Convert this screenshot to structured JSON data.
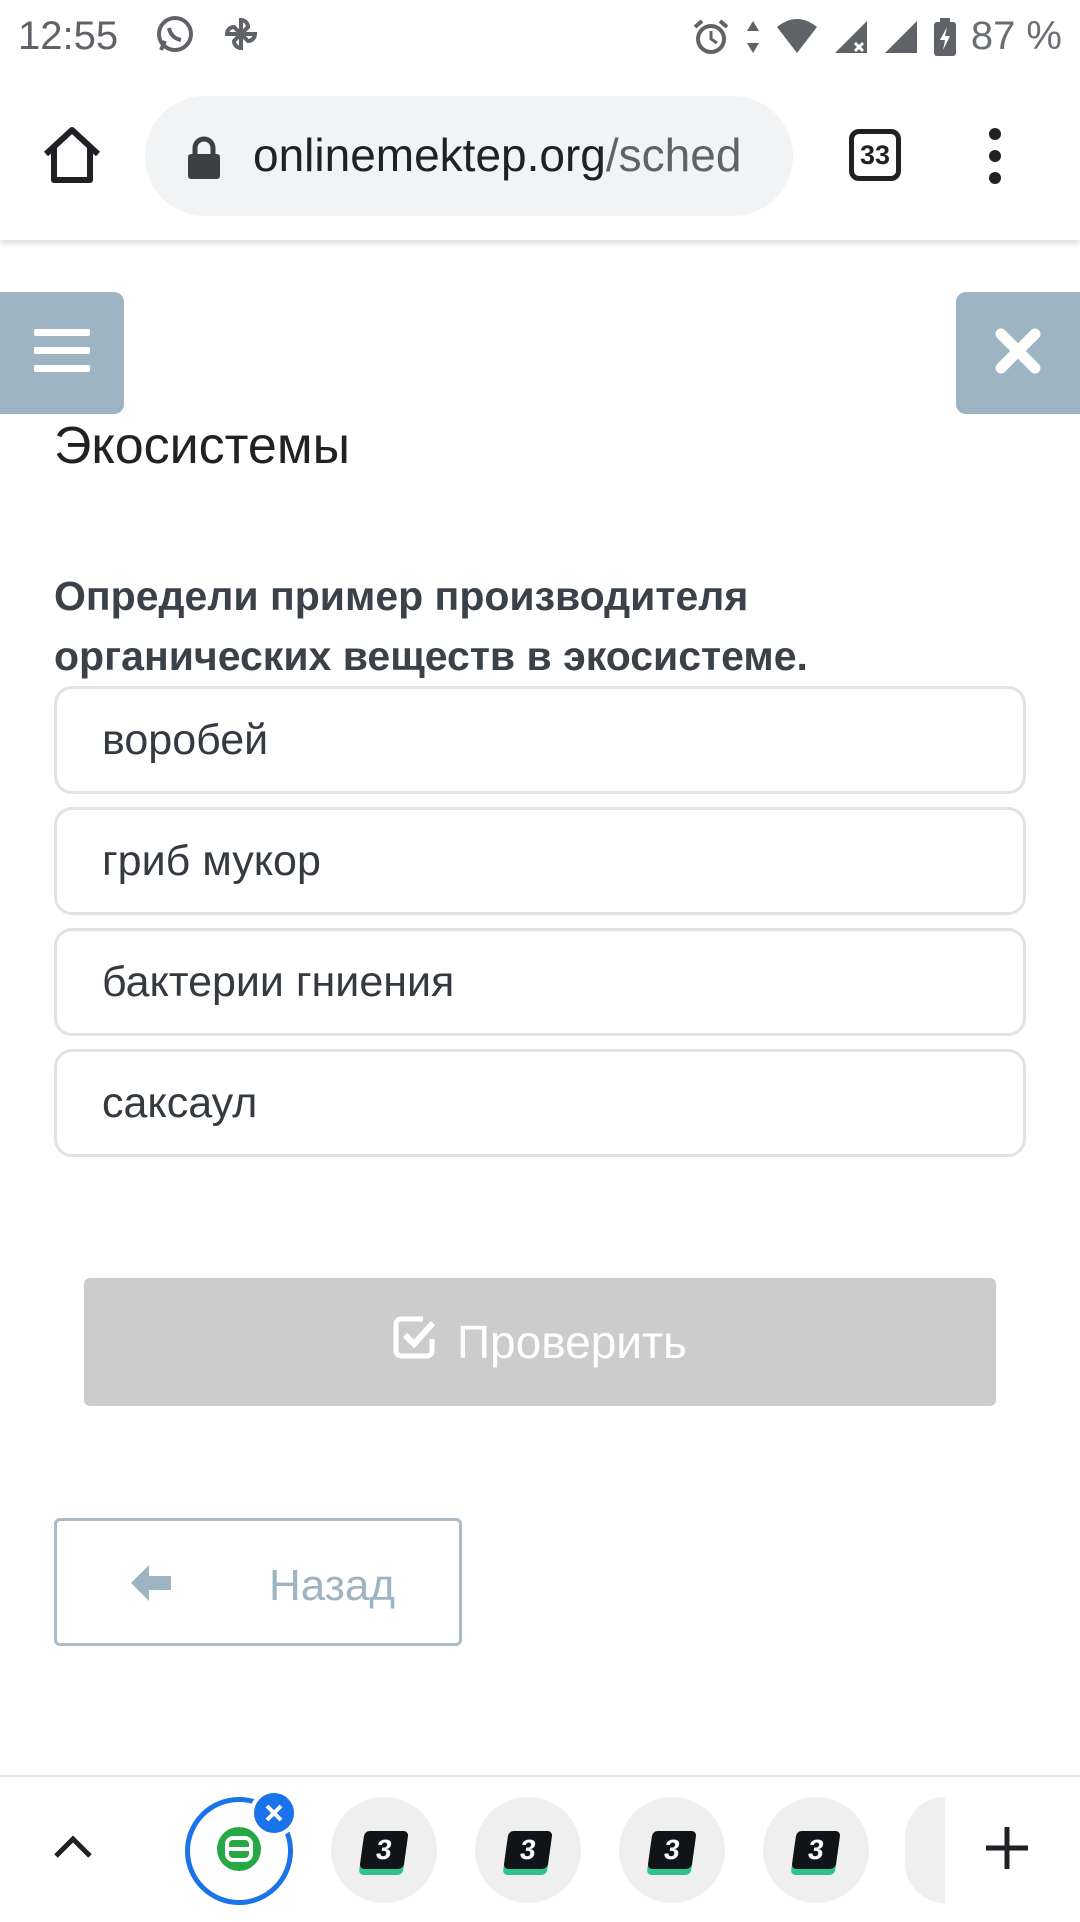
{
  "status_bar": {
    "time": "12:55",
    "battery_text": "87 %",
    "left_icons": [
      "whatsapp-icon",
      "pinwheel-icon"
    ],
    "right_icons": [
      "alarm-icon",
      "data-arrows-icon",
      "wifi-icon",
      "signal-x-icon",
      "signal-icon",
      "battery-icon"
    ]
  },
  "browser": {
    "url_host": "onlinemektep.org",
    "url_path": "/sched",
    "tab_count": "33"
  },
  "page": {
    "lesson_title": "Экосистемы",
    "question": "Определи пример производителя органических веществ в экосистеме.",
    "options": [
      "воробей",
      "гриб мукор",
      "бактерии гниения",
      "саксаул"
    ],
    "check_label": "Проверить",
    "back_label": "Назад"
  },
  "tab_strip": {
    "tabs": [
      {
        "favicon": "green-b-favicon",
        "active": true
      },
      {
        "favicon": "three-favicon",
        "label": "3"
      },
      {
        "favicon": "three-favicon",
        "label": "3"
      },
      {
        "favicon": "three-favicon",
        "label": "3"
      },
      {
        "favicon": "three-favicon",
        "label": "3"
      }
    ]
  },
  "colors": {
    "side_button": "#9eb4c2",
    "check_button_disabled": "#cccccc",
    "active_tab_ring": "#1a73e8",
    "favicon_accent": "#2fc28a"
  }
}
